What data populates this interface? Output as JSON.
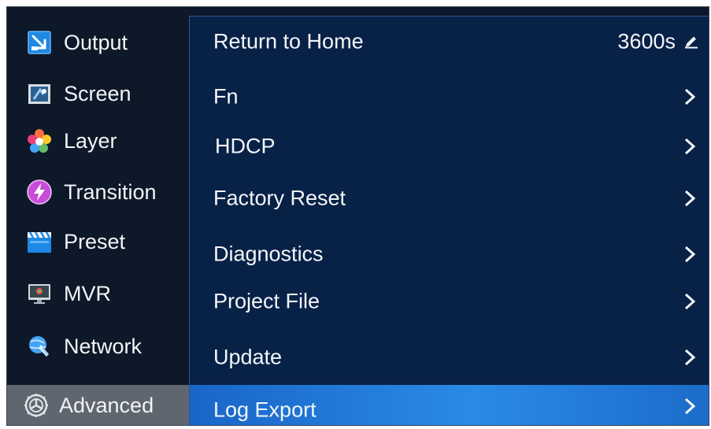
{
  "sidebar": {
    "items": [
      {
        "label": "Output",
        "icon": "output-icon"
      },
      {
        "label": "Screen",
        "icon": "screen-icon"
      },
      {
        "label": "Layer",
        "icon": "layer-icon"
      },
      {
        "label": "Transition",
        "icon": "transition-icon"
      },
      {
        "label": "Preset",
        "icon": "preset-icon"
      },
      {
        "label": "MVR",
        "icon": "mvr-icon"
      },
      {
        "label": "Network",
        "icon": "network-icon"
      },
      {
        "label": "Advanced",
        "icon": "advanced-gear-icon",
        "active": true
      }
    ]
  },
  "main": {
    "rows": [
      {
        "label": "Return to Home",
        "value": "3600s",
        "value_icon": "edit-pencil-icon"
      },
      {
        "label": "Fn",
        "icon": "chevron-right-icon"
      },
      {
        "label": "HDCP",
        "icon": "chevron-right-icon"
      },
      {
        "label": "Factory Reset",
        "icon": "chevron-right-icon"
      },
      {
        "label": "Diagnostics",
        "icon": "chevron-right-icon"
      },
      {
        "label": "Project File",
        "icon": "chevron-right-icon"
      },
      {
        "label": "Update",
        "icon": "chevron-right-icon"
      },
      {
        "label": "Log Export",
        "icon": "chevron-right-icon",
        "selected": true
      }
    ]
  },
  "colors": {
    "background": "#0c1829",
    "panel": "#082146",
    "selected_row": "#2a8ae6",
    "active_sidebar": "#5f666f",
    "text": "#f4f6fa"
  }
}
